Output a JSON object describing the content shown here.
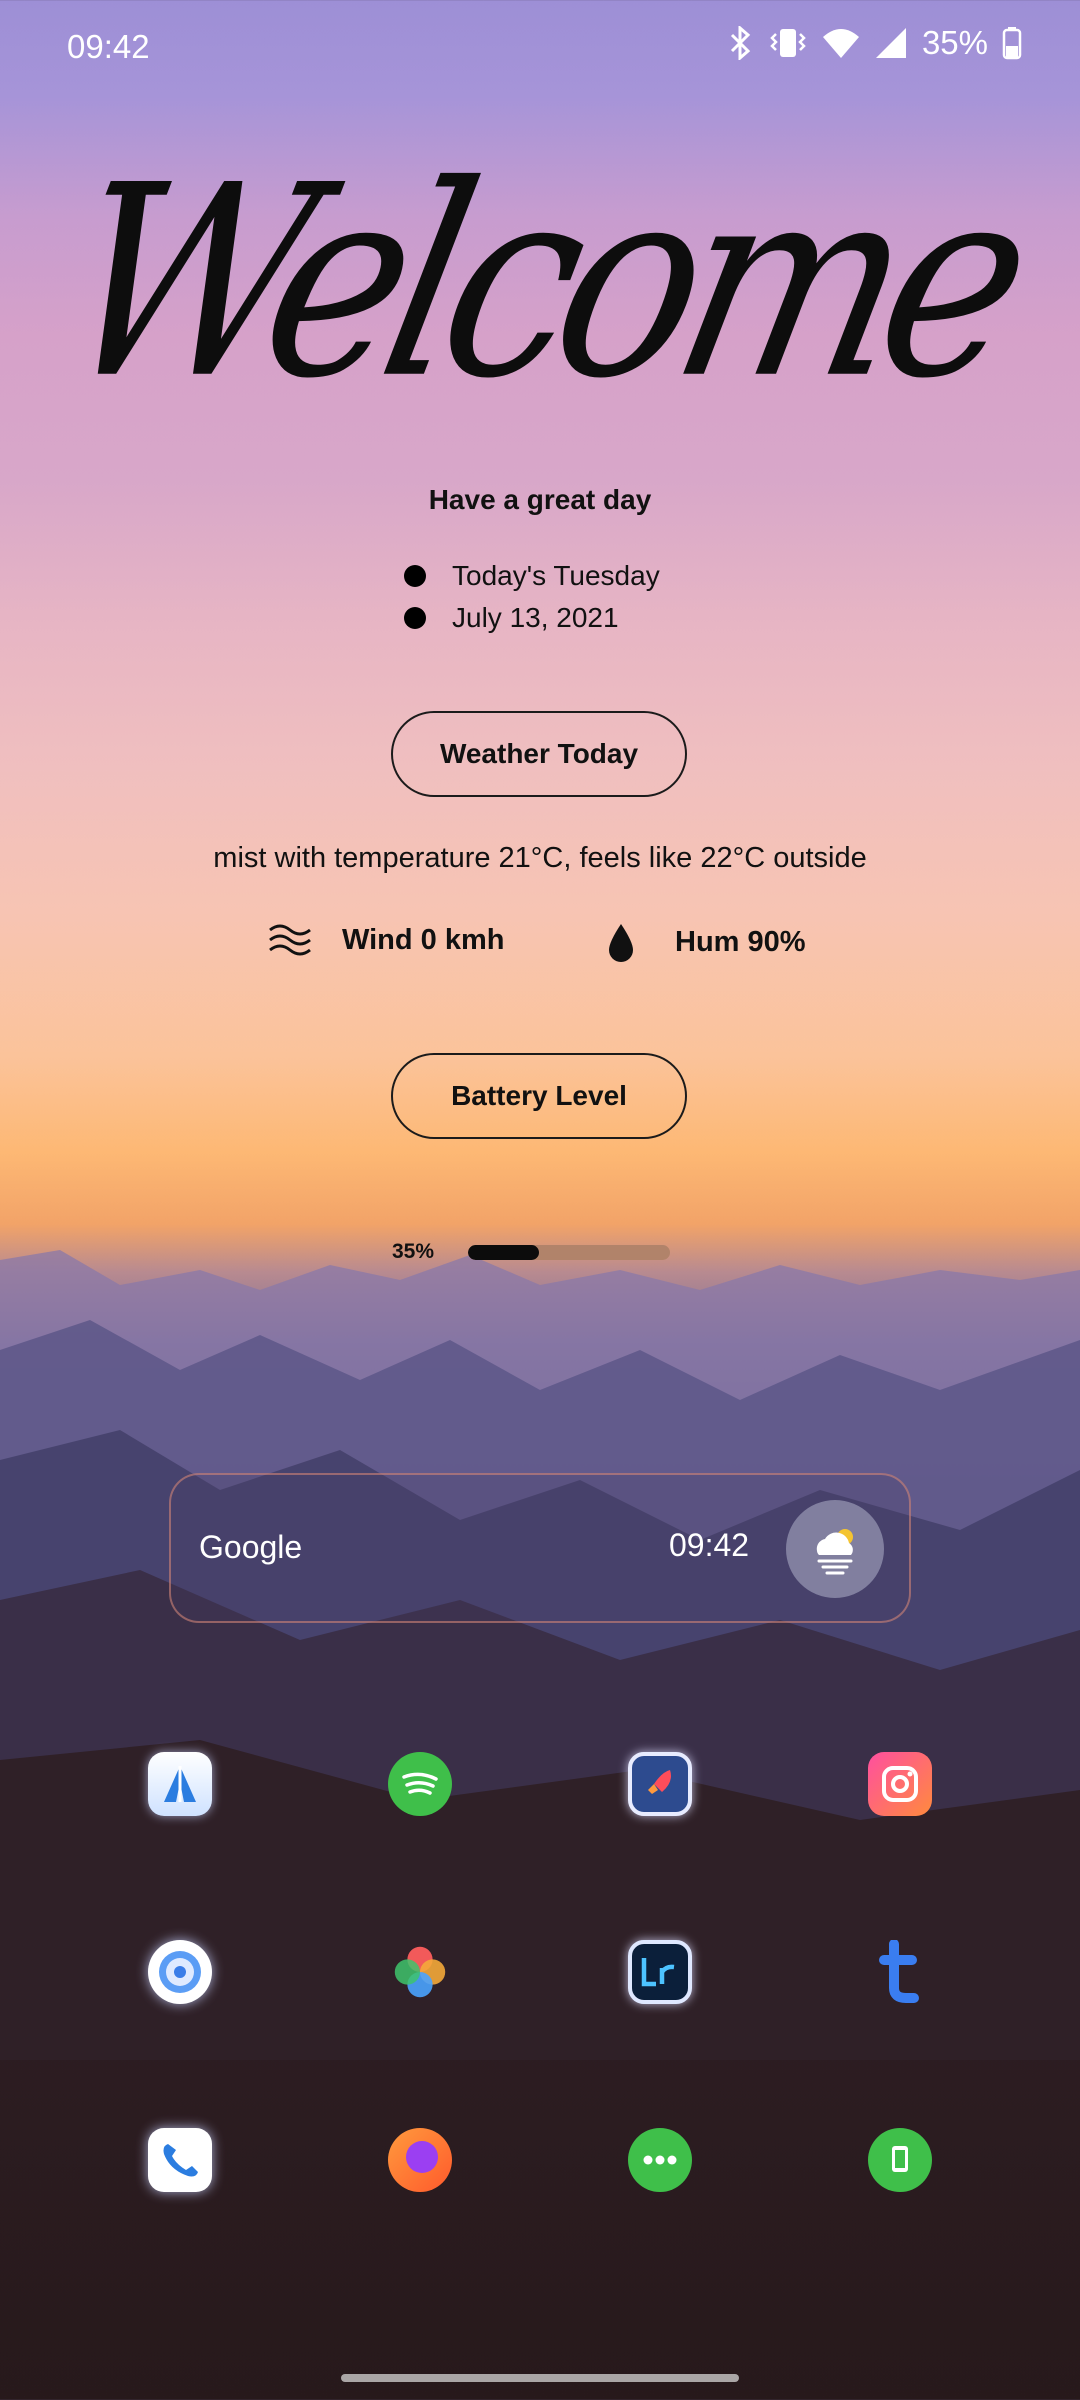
{
  "status_bar": {
    "time": "09:42",
    "battery": "35%"
  },
  "welcome_widget": {
    "heading": "Welcome",
    "subtitle": "Have a great day",
    "day_line": "Today's Tuesday",
    "date_line": "July 13, 2021"
  },
  "weather": {
    "button_label": "Weather Today",
    "summary": "mist with temperature 21°C, feels like 22°C outside",
    "wind": "Wind 0 kmh",
    "humidity": "Hum 90%"
  },
  "battery": {
    "button_label": "Battery Level",
    "percent_text": "35%",
    "level": 0.35
  },
  "google_widget": {
    "label": "Google",
    "time": "09:42",
    "weather_icon": "cloud-sun-fog-icon"
  },
  "apps": [
    {
      "icon": "app-store-icon"
    },
    {
      "icon": "spotify-icon"
    },
    {
      "icon": "rocket-app-icon"
    },
    {
      "icon": "instagram-icon"
    },
    {
      "icon": "browser-icon"
    },
    {
      "icon": "photos-icon"
    },
    {
      "icon": "lightroom-icon"
    },
    {
      "icon": "tumblr-icon"
    },
    {
      "icon": "phone-icon"
    },
    {
      "icon": "firefox-icon"
    },
    {
      "icon": "messages-icon"
    },
    {
      "icon": "whatsapp-icon"
    }
  ],
  "colors": {
    "accent_text": "#111111",
    "battery_track": "#b1836a",
    "battery_fill": "#0c0c0c"
  }
}
